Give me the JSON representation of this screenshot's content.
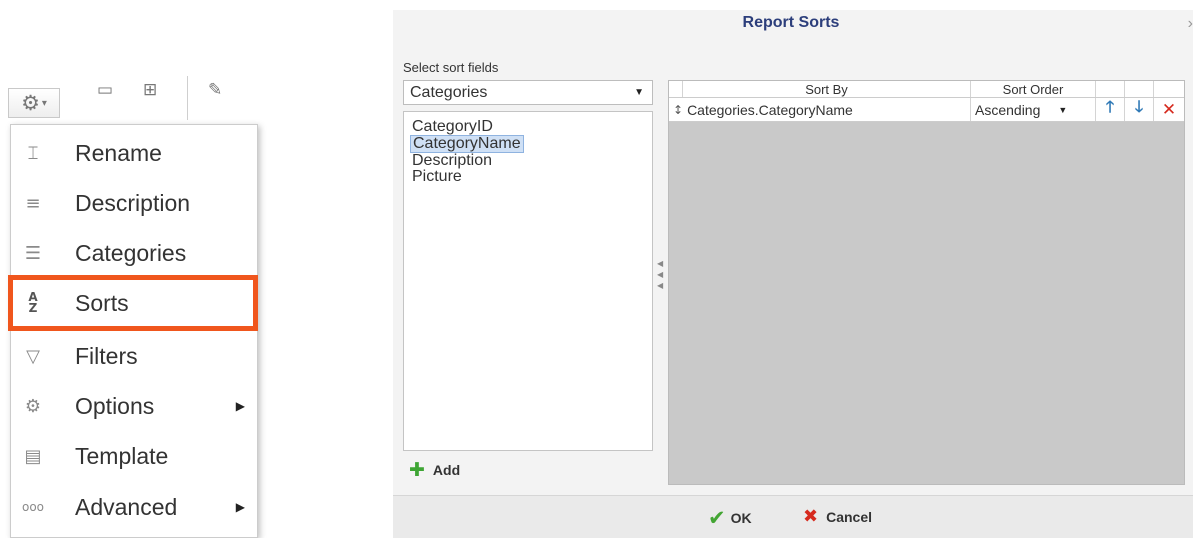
{
  "menu": {
    "items": [
      {
        "label": "Rename",
        "icon": "rename-icon",
        "has_submenu": false
      },
      {
        "label": "Description",
        "icon": "description-icon",
        "has_submenu": false
      },
      {
        "label": "Categories",
        "icon": "categories-icon",
        "has_submenu": false
      },
      {
        "label": "Sorts",
        "icon": "sort-az-icon",
        "has_submenu": false,
        "highlighted": true
      },
      {
        "label": "Filters",
        "icon": "filter-icon",
        "has_submenu": false
      },
      {
        "label": "Options",
        "icon": "gear-icon",
        "has_submenu": true
      },
      {
        "label": "Template",
        "icon": "template-icon",
        "has_submenu": false
      },
      {
        "label": "Advanced",
        "icon": "ellipsis-icon",
        "has_submenu": true
      }
    ],
    "highlight_color": "#f0561d"
  },
  "dialog": {
    "title": "Report Sorts",
    "select_label": "Select sort fields",
    "table_select_value": "Categories",
    "fields": [
      "CategoryID",
      "CategoryName",
      "Description",
      "Picture"
    ],
    "selected_field": "CategoryName",
    "add_label": "Add",
    "grid": {
      "columns": [
        "Sort By",
        "Sort Order"
      ],
      "rows": [
        {
          "sort_by": "Categories.CategoryName",
          "sort_order": "Ascending"
        }
      ]
    },
    "ok_label": "OK",
    "cancel_label": "Cancel"
  },
  "colors": {
    "title": "#2c3e7b",
    "ok_check": "#43a533",
    "cancel_x": "#d62a1e",
    "move_arrows": "#2f79b6"
  }
}
